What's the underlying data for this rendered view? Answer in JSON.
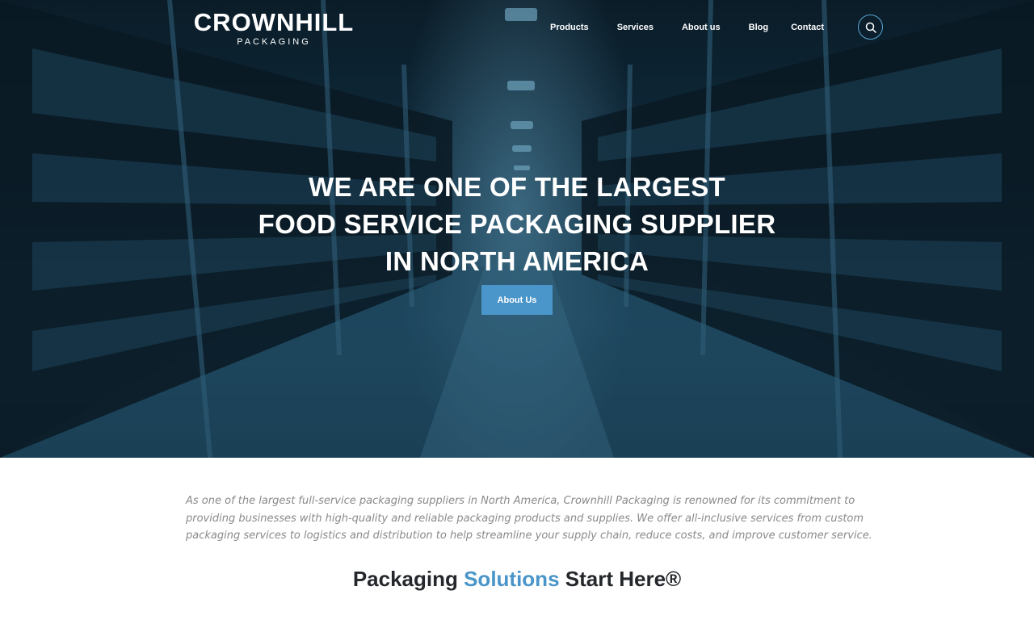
{
  "brand": {
    "name": "CROWNHILL",
    "tagline": "PACKAGING"
  },
  "nav": {
    "items": [
      "Products",
      "Services",
      "About us",
      "Blog",
      "Contact"
    ],
    "search_icon": "search-icon"
  },
  "hero": {
    "headline_lines": [
      "WE ARE ONE OF THE LARGEST",
      "FOOD SERVICE PACKAGING SUPPLIER",
      "IN NORTH AMERICA"
    ],
    "button_label": "About Us"
  },
  "intro": {
    "lines": [
      "As one of the largest full-service packaging suppliers in North America, Crownhill Packaging is renowned for its commitment to",
      "providing businesses with high-quality and reliable packaging products and supplies. We offer all-inclusive services from custom",
      "packaging services to logistics and distribution to help streamline your supply chain, reduce costs, and improve customer service."
    ]
  },
  "section": {
    "title_part1": "Packaging ",
    "title_accent": "Solutions",
    "title_part2": " Start Here®"
  },
  "colors": {
    "accent": "#4a95c9",
    "hero_overlay": "#1d4d68",
    "body_text": "#8a8a8a",
    "heading_text": "#24272b"
  }
}
